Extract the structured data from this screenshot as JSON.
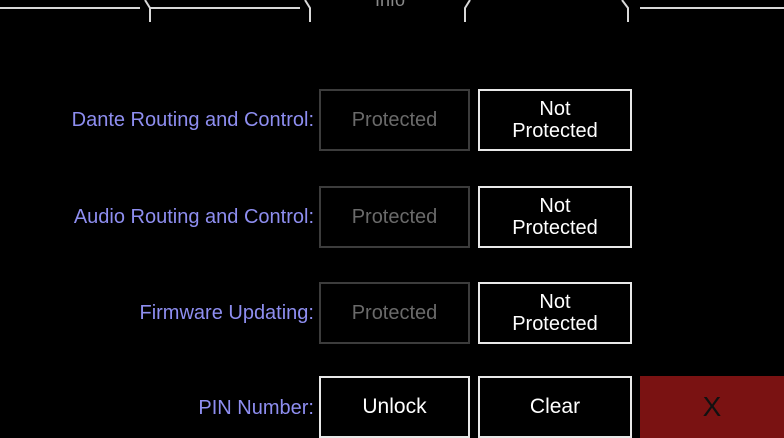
{
  "tabs": {
    "partial_label": "Info"
  },
  "settings": [
    {
      "label": "Dante Routing and Control:",
      "protected": "Protected",
      "not_protected": "Not\nProtected"
    },
    {
      "label": "Audio Routing and Control:",
      "protected": "Protected",
      "not_protected": "Not\nProtected"
    },
    {
      "label": "Firmware Updating:",
      "protected": "Protected",
      "not_protected": "Not\nProtected"
    }
  ],
  "pin": {
    "label": "PIN Number:",
    "unlock": "Unlock",
    "clear": "Clear",
    "close": "X"
  },
  "colors": {
    "label": "#8e8ef0",
    "close_bg": "#7a1212",
    "disabled_border": "#3c3c3c",
    "active_border": "#e8e8e8"
  }
}
